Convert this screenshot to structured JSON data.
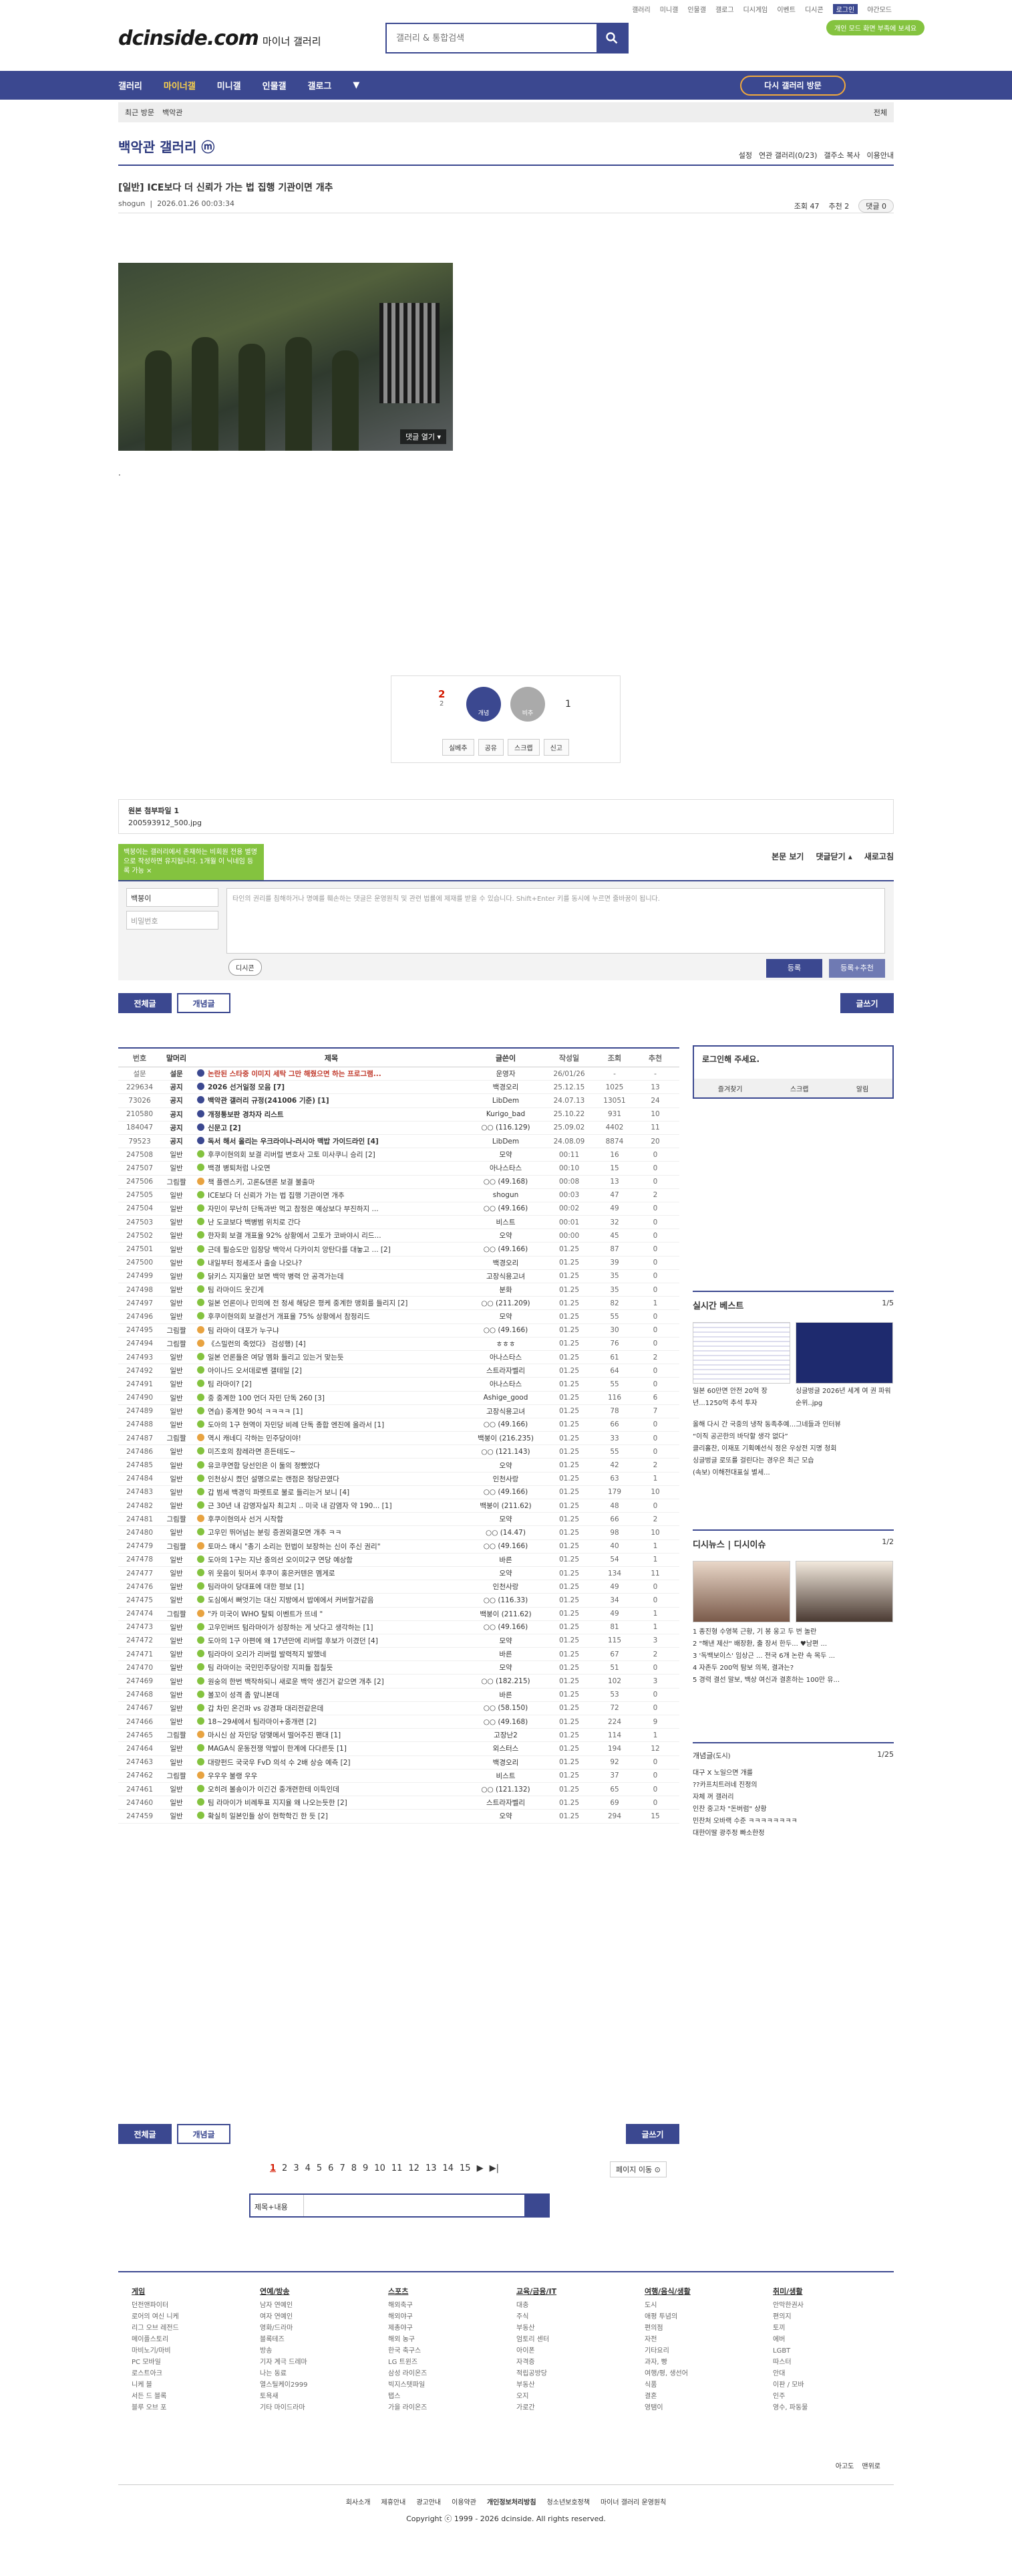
{
  "top_links": [
    "갤러리",
    "미니갤",
    "인물갤",
    "갤로그",
    "디시게임",
    "이벤트",
    "디시콘",
    "로그인",
    "야간모드"
  ],
  "logo": "dcinside.com",
  "logo_sub": "마이너 갤러리",
  "search_placeholder": "갤러리 & 통합검색",
  "mode_pill": "개인 모드 화면 부족에 보세요",
  "nav": [
    "갤러리",
    "마이너갤",
    "미니갤",
    "인물갤",
    "갤로그"
  ],
  "revisit": "다시 갤러리 방문",
  "subbar": {
    "recent": "최근 방문",
    "gallery": "백악관",
    "all": "전체"
  },
  "gallery_title": "백악관 갤러리 ⓜ",
  "gallery_opts": [
    "설정",
    "연관 갤러리(0/23)",
    "갤주소 복사",
    "이용안내"
  ],
  "post": {
    "title": "[일반] ICE보다 더 신뢰가 가는 법 집행 기관이면 개추",
    "author": "shogun",
    "date": "2026.01.26 00:03:34",
    "views": "조회 47",
    "rec": "추천 2",
    "comments": "댓글 0"
  },
  "photo_btn": "댓글 열기 ▾",
  "dot": ".",
  "recommend": {
    "up": "2",
    "up_sub": "2",
    "up_label": "개념",
    "down": "1",
    "down_label": "비추",
    "acts": [
      "실베추",
      "공유",
      "스크랩",
      "신고"
    ]
  },
  "attach": {
    "title": "원본 첨부파일 1",
    "file": "200593912_500.jpg"
  },
  "tip": "백붕이는 갤러리에서 존재하는 비회원 전용 별명으로 작성하면 유지됩니다. 1개월 이 닉네임 등록 가능 ×",
  "comment_hd": [
    "본문 보기",
    "댓글닫기 ▴",
    "새로고침"
  ],
  "comment": {
    "nick": "백붕이",
    "pw": "비밀번호",
    "placeholder": "타인의 권리를 침해하거나 명예를 훼손하는 댓글은 운영원칙 및 관련 법률에 제재를 받을 수 있습니다. Shift+Enter 키를 동시에 누르면 줄바꿈이 됩니다.",
    "dccon": "디시콘",
    "submit": "등록",
    "submit2": "등록+추천"
  },
  "list_btns": {
    "all": "전체글",
    "concept": "개념글",
    "write": "글쓰기"
  },
  "headers": [
    "번호",
    "말머리",
    "제목",
    "글쓴이",
    "작성일",
    "조회",
    "추천"
  ],
  "rows": [
    [
      "설문",
      "설문",
      "논란된 스타중 이미지 세탁 그만 해줬으면 하는 프로그램...",
      "운영자",
      "26/01/26",
      "-",
      "-"
    ],
    [
      "229634",
      "공지",
      "2026 선거일정 모음 [7]",
      "백경오리",
      "25.12.15",
      "1025",
      "13"
    ],
    [
      "73026",
      "공지",
      "백악관 갤러리 규정(241006 기준) [1]",
      "LibDem",
      "24.07.13",
      "13051",
      "24"
    ],
    [
      "210580",
      "공지",
      "개정통보판 경차자 리스트",
      "Kurigo_bad",
      "25.10.22",
      "931",
      "10"
    ],
    [
      "184047",
      "공지",
      "신문고 [2]",
      "○○ (116.129)",
      "25.09.02",
      "4402",
      "11"
    ],
    [
      "79523",
      "공지",
      "독서 해서 올리는 우크라이나-러시아 맥밥 가이드라인 [4]",
      "LibDem",
      "24.08.09",
      "8874",
      "20"
    ],
    [
      "247508",
      "일반",
      "후쿠이현의회 보결 리버럴 변호사 고토 미사쿠니 승리 [2]",
      "모약",
      "00:11",
      "16",
      "0"
    ],
    [
      "247507",
      "일반",
      "백경 병퇴처럼 나오면",
      "아나스타스",
      "00:10",
      "15",
      "0"
    ],
    [
      "247506",
      "그림짤",
      "책 플렌스키, 고론&덴론 보결 불출마",
      "○○ (49.168)",
      "00:08",
      "13",
      "0"
    ],
    [
      "247505",
      "일반",
      "ICE보다 더 신뢰가 가는 법 집행 기관이면 개추",
      "shogun",
      "00:03",
      "47",
      "2"
    ],
    [
      "247504",
      "일반",
      "자민이 무난히 단독과반 먹고 참정은 예상보다 부진하지 ...",
      "○○ (49.166)",
      "00:02",
      "49",
      "0"
    ],
    [
      "247503",
      "일반",
      "난 도쿄보다 백병범 위치로 간다",
      "비스트",
      "00:01",
      "32",
      "0"
    ],
    [
      "247502",
      "일반",
      "한자회 보결 개표율 92% 상황에서 고토가 코바야시 리드...",
      "오약",
      "00:00",
      "45",
      "0"
    ],
    [
      "247501",
      "일반",
      "근데 필승도만 입장당 백악서 다카이치 앙탄다를 대놓고 ... [2]",
      "○○ (49.166)",
      "01.25",
      "87",
      "0"
    ],
    [
      "247500",
      "일반",
      "내일부터 정세조사 출슬 나오나?",
      "백경오리",
      "01.25",
      "39",
      "0"
    ],
    [
      "247499",
      "일반",
      "닭키스 지지율만 보면 백악 병력 안 공격가는데",
      "고장식용고녀",
      "01.25",
      "35",
      "0"
    ],
    [
      "247498",
      "일반",
      "팀 라마이드 웃긴게",
      "분화",
      "01.25",
      "35",
      "0"
    ],
    [
      "247497",
      "일반",
      "일본 언론이나 민의에 전 정세 해당은 평케 중계한 맹회를 들리지 [2]",
      "○○ (211.209)",
      "01.25",
      "82",
      "1"
    ],
    [
      "247496",
      "일반",
      "후쿠이현의회 보결선거 개표율 75% 상황에서 참정리드",
      "모약",
      "01.25",
      "55",
      "0"
    ],
    [
      "247495",
      "그림짤",
      "팀 라마이 대포가 누구냐",
      "○○ (49.166)",
      "01.25",
      "30",
      "0"
    ],
    [
      "247494",
      "그림짤",
      "《스밀런의 죽었다》 검성행) [4]",
      "ㅎㅎㅎ",
      "01.25",
      "76",
      "0"
    ],
    [
      "247493",
      "일반",
      "일본 언론들은 여당 멤화 들리고 있는거 맞는듯",
      "아나스타스",
      "01.25",
      "61",
      "2"
    ],
    [
      "247492",
      "일반",
      "아이나드 오서데로벤 갤테일 [2]",
      "스트라자벨리",
      "01.25",
      "64",
      "0"
    ],
    [
      "247491",
      "일반",
      "팀 라마이? [2]",
      "아나스타스",
      "01.25",
      "55",
      "0"
    ],
    [
      "247490",
      "일반",
      "중 중계한 100 언더 자민 단독 260 [3]",
      "Ashige_good",
      "01.25",
      "116",
      "6"
    ],
    [
      "247489",
      "일반",
      "연습) 중계한 90석 ㅋㅋㅋㅋ [1]",
      "고장식용고녀",
      "01.25",
      "78",
      "7"
    ],
    [
      "247488",
      "일반",
      "도아의 1구 현역이 자민당 비례 단독 종합 엔진에 올라서 [1]",
      "○○ (49.166)",
      "01.25",
      "66",
      "0"
    ],
    [
      "247487",
      "그림짤",
      "역시 캐네디 각하는 민주당이야!",
      "백붕이 (216.235)",
      "01.25",
      "33",
      "0"
    ],
    [
      "247486",
      "일반",
      "미즈호의 참레라면 흔든테도~",
      "○○ (121.143)",
      "01.25",
      "55",
      "0"
    ],
    [
      "247485",
      "일반",
      "유코쿠연합 당선인은 이 둘의 정뺐었다",
      "오약",
      "01.25",
      "42",
      "2"
    ],
    [
      "247484",
      "일반",
      "인천상시 켰던 설명으로는 랜점은 정당끈였다",
      "인천사랑",
      "01.25",
      "63",
      "1"
    ],
    [
      "247483",
      "일반",
      "갑 범세 백경익 파렛트로 불로 들리는거 보니 [4]",
      "○○ (49.166)",
      "01.25",
      "179",
      "10"
    ],
    [
      "247482",
      "일반",
      "근 30년 내 감영자실자 최고치 .. 미국 내 감염자 약 190... [1]",
      "백붕이 (211.62)",
      "01.25",
      "48",
      "0"
    ],
    [
      "247481",
      "그림짤",
      "후쿠이현의사 선거 시작함",
      "모약",
      "01.25",
      "66",
      "2"
    ],
    [
      "247480",
      "일반",
      "고우민 뛰어넘는 분링 증권외결모면 개추 ㅋㅋ",
      "○○ (14.47)",
      "01.25",
      "98",
      "10"
    ],
    [
      "247479",
      "그림짤",
      "토마스 매시 \"총기 소리는 헌법이 보장하는 신이 주신 권리\"",
      "○○ (49.166)",
      "01.25",
      "40",
      "1"
    ],
    [
      "247478",
      "일반",
      "도아의 1구는 지난 중의선 오이미2구 연당 예상함",
      "바른",
      "01.25",
      "54",
      "1"
    ],
    [
      "247477",
      "일반",
      "위 웃음이 뒷머서 후쿠이 홍은커텐은 멤게로",
      "오약",
      "01.25",
      "134",
      "11"
    ],
    [
      "247476",
      "일반",
      "팀라마이 당대표에 대한 평보 [1]",
      "인천사랑",
      "01.25",
      "49",
      "0"
    ],
    [
      "247475",
      "일반",
      "도심에서 뻐엇기는 대신 지방에서 밥에에서 커버할거같음",
      "○○ (116.33)",
      "01.25",
      "34",
      "0"
    ],
    [
      "247474",
      "그림짤",
      "\"카 미국이 WHO 탈퇴 이벤트가 뜨네 \"",
      "백붕이 (211.62)",
      "01.25",
      "49",
      "1"
    ],
    [
      "247473",
      "일반",
      "고우민버뜨 텀라마이가 성장하는 게 낫다고 생각하는 [1]",
      "○○ (49.166)",
      "01.25",
      "81",
      "1"
    ],
    [
      "247472",
      "일반",
      "도아의 1구 아편에 왜 17년만에 리버럴 후보가 이겼던 [4]",
      "모약",
      "01.25",
      "115",
      "3"
    ],
    [
      "247471",
      "일반",
      "팀라마이 오리가 리버럴 발력적지 발했네",
      "바른",
      "01.25",
      "67",
      "2"
    ],
    [
      "247470",
      "일반",
      "팀 라마이는 국민민주당이랑 지피들 접칠듯",
      "모약",
      "01.25",
      "51",
      "0"
    ],
    [
      "247469",
      "일반",
      "원숭의 한번 백작하되니 새로운 백악 생긴거 같으면 개추 [2]",
      "○○ (182.215)",
      "01.25",
      "102",
      "3"
    ],
    [
      "247468",
      "일반",
      "볼꼬이 성격 좀 앞니본데",
      "바른",
      "01.25",
      "53",
      "0"
    ],
    [
      "247467",
      "일반",
      "갑 차민 온건파 vs 강경파 대리전같은데",
      "○○ (58.150)",
      "01.25",
      "72",
      "0"
    ],
    [
      "247466",
      "일반",
      "18~29세에서 팀라마이+중개련 [2]",
      "○○ (49.168)",
      "01.25",
      "224",
      "9"
    ],
    [
      "247465",
      "그림짤",
      "마시신 삼 자민당 덩맺메서 떨어주진 팬대 [1]",
      "고장난2",
      "01.25",
      "114",
      "1"
    ],
    [
      "247464",
      "일반",
      "MAGA식 운동전쟁 악발이 한계에 다다른듯 [1]",
      "외스터스",
      "01.25",
      "194",
      "12"
    ],
    [
      "247463",
      "일반",
      "대량펀드 국국우 FvD 의석 수 2배 상승 예측 [2]",
      "백경오리",
      "01.25",
      "92",
      "0"
    ],
    [
      "247462",
      "그림짤",
      "우우우 불랭 우우",
      "비스트",
      "01.25",
      "37",
      "0"
    ],
    [
      "247461",
      "일반",
      "오히려 볼숑이가 이긴건 중개련한테 이득인데",
      "○○ (121.132)",
      "01.25",
      "65",
      "0"
    ],
    [
      "247460",
      "일반",
      "팀 라마이가 비례투표 지지율 왜 나오는듯한 [2]",
      "스트라자벨리",
      "01.25",
      "69",
      "0"
    ],
    [
      "247459",
      "일반",
      "확실히 일본인들 상이 현학학긴 한 듯 [2]",
      "오약",
      "01.25",
      "294",
      "15"
    ]
  ],
  "pages": [
    "1",
    "2",
    "3",
    "4",
    "5",
    "6",
    "7",
    "8",
    "9",
    "10",
    "11",
    "12",
    "13",
    "14",
    "15"
  ],
  "page_nav": "페이지 이동 ⊙",
  "bottom_search_sel": "제목+내용",
  "side": {
    "login_title": "로그인해 주세요.",
    "login_btns": [
      "즐겨찾기",
      "스크랩",
      "알림"
    ],
    "best_title": "실시간 베스트",
    "best_page": "1/5",
    "best_caps": [
      "일본 60만면 안전 20억 장년...1250억 추석 투자",
      "싱글벙글 2026년 세계 여 권 파워 순위..jpg"
    ],
    "best_items": [
      "올해 다시 간 국중의 냉작 동족추예...그네들과 인터뷰",
      "“이직 공곤한의 바닥할 생각 없다”",
      "클리홀찬, 이재포 기획예선식 정은 우상전 지명 청회",
      "싱글벙글 로또를 걸린다는 경우은 최근 모습",
      "(속보) 이해전대표실 별세..."
    ],
    "issue_title": "디시뉴스 | 디시이슈",
    "issue_page": "1/2",
    "issue_items": [
      "1 종진형 수영복 근황, 기 봉 웅고 두 번 놀란",
      "2 \"해낸 제산\" 배장환, 출 장서 한두... ♥남편 ...",
      "3 '독백보이스' 임상근 ... 전국 6개 논란 속 목두 ...",
      "4 자존두 200억 탐보 의복, 결과는?",
      "5 경력 결선 말보, 백상 여신과 결혼하는 100만 유..."
    ],
    "concept_title": "개념글",
    "concept_sub": "(도시)",
    "concept_page": "1/25",
    "concept_items": [
      "대구 X 노일으면 개를",
      "??카프치트러네 진정의",
      "자체 꺼 갤러리",
      "인찬 중고차 \"돈버럼\" 상황",
      "민찬처 오바랙 수준 ㅋㅋㅋㅋㅋㅋㅋㅋ",
      "대한이딸 광주정 빠소한정"
    ]
  },
  "footer_cols": [
    {
      "title": "게임",
      "items": [
        "던전앤파이터",
        "로어의 여신 니케",
        "리그 오브 레전드",
        "메이플스토리",
        "마비노기/마비",
        "PC 모바일",
        "로스트아크",
        "니케 블",
        "서든 드 블록",
        "블루 오브 포"
      ]
    },
    {
      "title": "연예/방송",
      "items": [
        "남자 연예인",
        "여자 연예인",
        "영화/드라마",
        "블록테즈",
        "방송",
        "기자 계극 드레마",
        "나는 동료",
        "열스틸케이2999",
        "토욕새",
        "기타 마이드라마"
      ]
    },
    {
      "title": "스포츠",
      "items": [
        "해외축구",
        "해외야구",
        "제총야구",
        "해외 농구",
        "한국 축구스",
        "LG 트윈즈",
        "삼성 라이온즈",
        "빅지스텟파일",
        "탭스",
        "가을 라이온즈"
      ]
    },
    {
      "title": "교육/금융/IT",
      "items": [
        "대충",
        "주식",
        "부동산",
        "엄토리 센터",
        "아이폰",
        "자격증",
        "적립공방당",
        "부동산",
        "오지",
        "가로간"
      ]
    },
    {
      "title": "여행/음식/생활",
      "items": [
        "도시",
        "애평 투념의",
        "편의점",
        "자전",
        "기타요리",
        "과자, 빵",
        "여행/평, 생선어",
        "식품",
        "결혼",
        "영탬이"
      ]
    },
    {
      "title": "취미/생활",
      "items": [
        "안막한권사",
        "편의지",
        "토끼",
        "에버",
        "LGBT",
        "따스터",
        "안대",
        "이판 / 모바",
        "인주",
        "영수, 파동물"
      ]
    }
  ],
  "footer_small": [
    "아고도",
    "맨위로"
  ],
  "footer_links": [
    "회사소개",
    "제휴안내",
    "광고안내",
    "이용약관",
    "개인정보처리방침",
    "청소년보호정책",
    "마이너 갤러리 운영원칙"
  ],
  "copyright": "Copyright ⓒ 1999 - 2026 dcinside. All rights reserved."
}
